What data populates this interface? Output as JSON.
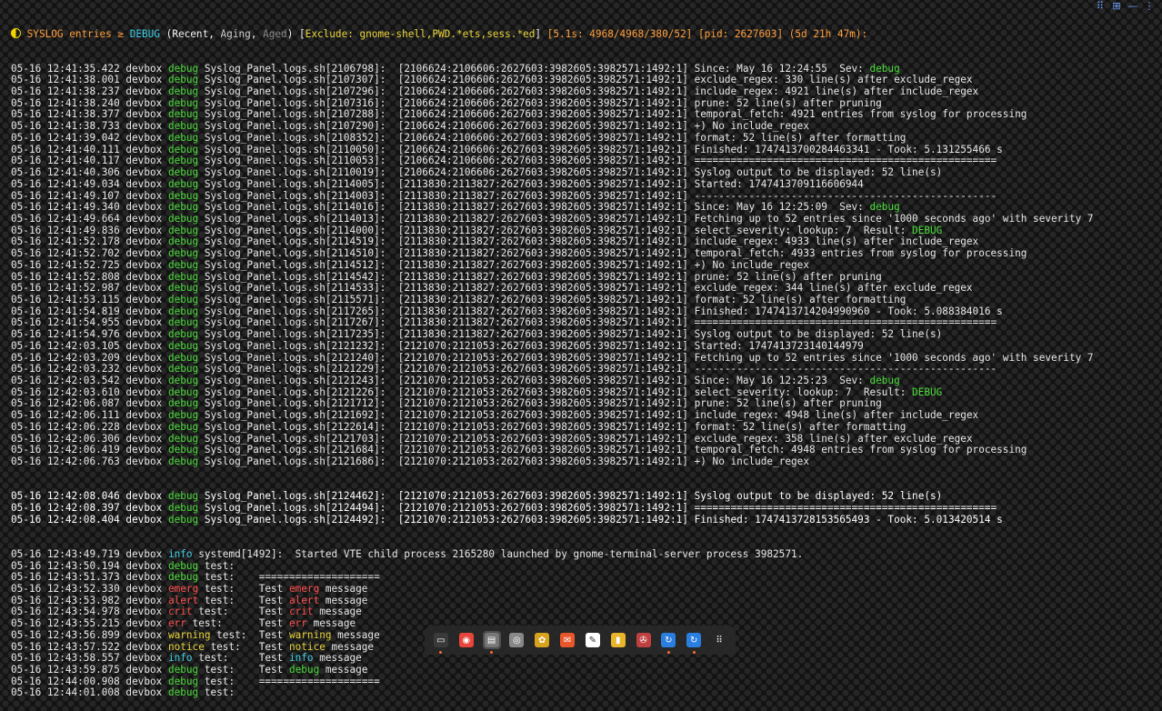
{
  "header": {
    "parts": [
      {
        "text": " SYSLOG entries ",
        "cls": "orange"
      },
      {
        "text": "≥ ",
        "cls": "orange"
      },
      {
        "text": "DEBUG",
        "cls": "cyan"
      },
      {
        "text": " (",
        "cls": "wht"
      },
      {
        "text": "Recent",
        "cls": "wht"
      },
      {
        "text": ", ",
        "cls": "wht"
      },
      {
        "text": "Aging",
        "cls": "dim"
      },
      {
        "text": ", ",
        "cls": "wht"
      },
      {
        "text": "Aged",
        "cls": "gry"
      },
      {
        "text": ") [",
        "cls": "wht"
      },
      {
        "text": "Exclude: gnome-shell,PWD.*ets,sess.*ed",
        "cls": "yel"
      },
      {
        "text": "] ",
        "cls": "wht"
      },
      {
        "text": "[5.1s: 4968/4968/380/52] [pid: 2627603] (5d 21h 47m):",
        "cls": "orange"
      }
    ]
  },
  "colors": {
    "background": "#121212",
    "text": "#e8e8e8",
    "orange": "#ff9e3d",
    "debug": "#4cdc3c",
    "cyan": "#3fd0e8",
    "red": "#ff4d4d",
    "yellow": "#e9d43a"
  },
  "debug_lines": [
    [
      "05-16 12:41:35.422",
      "Syslog_Panel.logs.sh[2106798]:",
      "[2106624:2106606:2627603:3982605:3982571:1492:1]",
      [
        {
          "t": "Since: May 16 12:24:55  Sev: "
        },
        {
          "t": "debug",
          "c": "grn"
        }
      ]
    ],
    [
      "05-16 12:41:38.001",
      "Syslog_Panel.logs.sh[2107307]:",
      "[2106624:2106606:2627603:3982605:3982571:1492:1]",
      [
        {
          "t": "exclude_regex: 330 line(s) after exclude_regex"
        }
      ]
    ],
    [
      "05-16 12:41:38.237",
      "Syslog_Panel.logs.sh[2107296]:",
      "[2106624:2106606:2627603:3982605:3982571:1492:1]",
      [
        {
          "t": "include_regex: 4921 line(s) after include_regex"
        }
      ]
    ],
    [
      "05-16 12:41:38.240",
      "Syslog_Panel.logs.sh[2107316]:",
      "[2106624:2106606:2627603:3982605:3982571:1492:1]",
      [
        {
          "t": "prune: 52 line(s) after pruning"
        }
      ]
    ],
    [
      "05-16 12:41:38.377",
      "Syslog_Panel.logs.sh[2107288]:",
      "[2106624:2106606:2627603:3982605:3982571:1492:1]",
      [
        {
          "t": "temporal_fetch: 4921 entries from syslog for processing"
        }
      ]
    ],
    [
      "05-16 12:41:38.733",
      "Syslog_Panel.logs.sh[2107290]:",
      "[2106624:2106606:2627603:3982605:3982571:1492:1]",
      [
        {
          "t": "+) No include_regex"
        }
      ]
    ],
    [
      "05-16 12:41:39.042",
      "Syslog_Panel.logs.sh[2108352]:",
      "[2106624:2106606:2627603:3982605:3982571:1492:1]",
      [
        {
          "t": "format: 52 line(s) after formatting"
        }
      ]
    ],
    [
      "05-16 12:41:40.111",
      "Syslog_Panel.logs.sh[2110050]:",
      "[2106624:2106606:2627603:3982605:3982571:1492:1]",
      [
        {
          "t": "Finished: 1747413700284463341 - Took: 5.131255466 s"
        }
      ]
    ],
    [
      "05-16 12:41:40.117",
      "Syslog_Panel.logs.sh[2110053]:",
      "[2106624:2106606:2627603:3982605:3982571:1492:1]",
      [
        {
          "t": "=================================================="
        }
      ]
    ],
    [
      "05-16 12:41:40.306",
      "Syslog_Panel.logs.sh[2110019]:",
      "[2106624:2106606:2627603:3982605:3982571:1492:1]",
      [
        {
          "t": "Syslog output to be displayed: 52 line(s)"
        }
      ]
    ],
    [
      "05-16 12:41:49.034",
      "Syslog_Panel.logs.sh[2114005]:",
      "[2113830:2113827:2627603:3982605:3982571:1492:1]",
      [
        {
          "t": "Started: 1747413709116606944"
        }
      ]
    ],
    [
      "05-16 12:41:49.107",
      "Syslog_Panel.logs.sh[2114003]:",
      "[2113830:2113827:2627603:3982605:3982571:1492:1]",
      [
        {
          "t": "--------------------------------------------------"
        }
      ]
    ],
    [
      "05-16 12:41:49.340",
      "Syslog_Panel.logs.sh[2114016]:",
      "[2113830:2113827:2627603:3982605:3982571:1492:1]",
      [
        {
          "t": "Since: May 16 12:25:09  Sev: "
        },
        {
          "t": "debug",
          "c": "grn"
        }
      ]
    ],
    [
      "05-16 12:41:49.664",
      "Syslog_Panel.logs.sh[2114013]:",
      "[2113830:2113827:2627603:3982605:3982571:1492:1]",
      [
        {
          "t": "Fetching up to 52 entries since '1000 seconds ago' with severity 7"
        }
      ]
    ],
    [
      "05-16 12:41:49.836",
      "Syslog_Panel.logs.sh[2114000]:",
      "[2113830:2113827:2627603:3982605:3982571:1492:1]",
      [
        {
          "t": "select_severity: lookup: 7  Result: "
        },
        {
          "t": "DEBUG",
          "c": "grn"
        }
      ]
    ],
    [
      "05-16 12:41:52.178",
      "Syslog_Panel.logs.sh[2114519]:",
      "[2113830:2113827:2627603:3982605:3982571:1492:1]",
      [
        {
          "t": "include_regex: 4933 line(s) after include_regex"
        }
      ]
    ],
    [
      "05-16 12:41:52.702",
      "Syslog_Panel.logs.sh[2114510]:",
      "[2113830:2113827:2627603:3982605:3982571:1492:1]",
      [
        {
          "t": "temporal_fetch: 4933 entries from syslog for processing"
        }
      ]
    ],
    [
      "05-16 12:41:52.725",
      "Syslog_Panel.logs.sh[2114512]:",
      "[2113830:2113827:2627603:3982605:3982571:1492:1]",
      [
        {
          "t": "+) No include_regex"
        }
      ]
    ],
    [
      "05-16 12:41:52.808",
      "Syslog_Panel.logs.sh[2114542]:",
      "[2113830:2113827:2627603:3982605:3982571:1492:1]",
      [
        {
          "t": "prune: 52 line(s) after pruning"
        }
      ]
    ],
    [
      "05-16 12:41:52.987",
      "Syslog_Panel.logs.sh[2114533]:",
      "[2113830:2113827:2627603:3982605:3982571:1492:1]",
      [
        {
          "t": "exclude_regex: 344 line(s) after exclude_regex"
        }
      ]
    ],
    [
      "05-16 12:41:53.115",
      "Syslog_Panel.logs.sh[2115571]:",
      "[2113830:2113827:2627603:3982605:3982571:1492:1]",
      [
        {
          "t": "format: 52 line(s) after formatting"
        }
      ]
    ],
    [
      "05-16 12:41:54.819",
      "Syslog_Panel.logs.sh[2117265]:",
      "[2113830:2113827:2627603:3982605:3982571:1492:1]",
      [
        {
          "t": "Finished: 1747413714204990960 - Took: 5.088384016 s"
        }
      ]
    ],
    [
      "05-16 12:41:54.955",
      "Syslog_Panel.logs.sh[2117267]:",
      "[2113830:2113827:2627603:3982605:3982571:1492:1]",
      [
        {
          "t": "=================================================="
        }
      ]
    ],
    [
      "05-16 12:41:54.976",
      "Syslog_Panel.logs.sh[2117235]:",
      "[2113830:2113827:2627603:3982605:3982571:1492:1]",
      [
        {
          "t": "Syslog output to be displayed: 52 line(s)"
        }
      ]
    ],
    [
      "05-16 12:42:03.105",
      "Syslog_Panel.logs.sh[2121232]:",
      "[2121070:2121053:2627603:3982605:3982571:1492:1]",
      [
        {
          "t": "Started: 1747413723140144979"
        }
      ]
    ],
    [
      "05-16 12:42:03.209",
      "Syslog_Panel.logs.sh[2121240]:",
      "[2121070:2121053:2627603:3982605:3982571:1492:1]",
      [
        {
          "t": "Fetching up to 52 entries since '1000 seconds ago' with severity 7"
        }
      ]
    ],
    [
      "05-16 12:42:03.232",
      "Syslog_Panel.logs.sh[2121229]:",
      "[2121070:2121053:2627603:3982605:3982571:1492:1]",
      [
        {
          "t": "--------------------------------------------------"
        }
      ]
    ],
    [
      "05-16 12:42:03.542",
      "Syslog_Panel.logs.sh[2121243]:",
      "[2121070:2121053:2627603:3982605:3982571:1492:1]",
      [
        {
          "t": "Since: May 16 12:25:23  Sev: "
        },
        {
          "t": "debug",
          "c": "grn"
        }
      ]
    ],
    [
      "05-16 12:42:03.610",
      "Syslog_Panel.logs.sh[2121226]:",
      "[2121070:2121053:2627603:3982605:3982571:1492:1]",
      [
        {
          "t": "select_severity: lookup: 7  Result: "
        },
        {
          "t": "DEBUG",
          "c": "grn"
        }
      ]
    ],
    [
      "05-16 12:42:06.087",
      "Syslog_Panel.logs.sh[2121712]:",
      "[2121070:2121053:2627603:3982605:3982571:1492:1]",
      [
        {
          "t": "prune: 52 line(s) after pruning"
        }
      ]
    ],
    [
      "05-16 12:42:06.111",
      "Syslog_Panel.logs.sh[2121692]:",
      "[2121070:2121053:2627603:3982605:3982571:1492:1]",
      [
        {
          "t": "include_regex: 4948 line(s) after include_regex"
        }
      ]
    ],
    [
      "05-16 12:42:06.228",
      "Syslog_Panel.logs.sh[2122614]:",
      "[2121070:2121053:2627603:3982605:3982571:1492:1]",
      [
        {
          "t": "format: 52 line(s) after formatting"
        }
      ]
    ],
    [
      "05-16 12:42:06.306",
      "Syslog_Panel.logs.sh[2121703]:",
      "[2121070:2121053:2627603:3982605:3982571:1492:1]",
      [
        {
          "t": "exclude_regex: 358 line(s) after exclude_regex"
        }
      ]
    ],
    [
      "05-16 12:42:06.419",
      "Syslog_Panel.logs.sh[2121684]:",
      "[2121070:2121053:2627603:3982605:3982571:1492:1]",
      [
        {
          "t": "temporal_fetch: 4948 entries from syslog for processing"
        }
      ]
    ],
    [
      "05-16 12:42:06.763",
      "Syslog_Panel.logs.sh[2121686]:",
      "[2121070:2121053:2627603:3982605:3982571:1492:1]",
      [
        {
          "t": "+) No include_regex"
        }
      ]
    ]
  ],
  "recent_lines": [
    [
      "05-16 12:42:08.046",
      "Syslog_Panel.logs.sh[2124462]:",
      "[2121070:2121053:2627603:3982605:3982571:1492:1]",
      [
        {
          "t": "Syslog output to be displayed: 52 line(s)"
        }
      ]
    ],
    [
      "05-16 12:42:08.397",
      "Syslog_Panel.logs.sh[2124494]:",
      "[2121070:2121053:2627603:3982605:3982571:1492:1]",
      [
        {
          "t": "=================================================="
        }
      ]
    ],
    [
      "05-16 12:42:08.404",
      "Syslog_Panel.logs.sh[2124492]:",
      "[2121070:2121053:2627603:3982605:3982571:1492:1]",
      [
        {
          "t": "Finished: 1747413728153565493 - Took: 5.013420514 s"
        }
      ]
    ]
  ],
  "tail_lines": [
    {
      "ts": "05-16 12:43:49.719",
      "host": "devbox",
      "sev": "info",
      "sevc": "cyan",
      "rest": [
        {
          "t": " systemd[1492]:  Started VTE child process 2165280 launched by gnome-terminal-server process 3982571."
        }
      ]
    },
    {
      "ts": "05-16 12:43:50.194",
      "host": "devbox",
      "sev": "debug",
      "sevc": "grn",
      "rest": [
        {
          "t": " test:"
        }
      ]
    },
    {
      "ts": "05-16 12:43:51.373",
      "host": "devbox",
      "sev": "debug",
      "sevc": "grn",
      "rest": [
        {
          "t": " test:    ===================="
        }
      ]
    },
    {
      "ts": "05-16 12:43:52.330",
      "host": "devbox",
      "sev": "emerg",
      "sevc": "red",
      "rest": [
        {
          "t": " test:    Test "
        },
        {
          "t": "emerg",
          "c": "red"
        },
        {
          "t": " message"
        }
      ]
    },
    {
      "ts": "05-16 12:43:53.982",
      "host": "devbox",
      "sev": "alert",
      "sevc": "red",
      "rest": [
        {
          "t": " test:    Test "
        },
        {
          "t": "alert",
          "c": "red"
        },
        {
          "t": " message"
        }
      ]
    },
    {
      "ts": "05-16 12:43:54.978",
      "host": "devbox",
      "sev": "crit",
      "sevc": "red",
      "rest": [
        {
          "t": " test:     Test "
        },
        {
          "t": "crit",
          "c": "red"
        },
        {
          "t": " message"
        }
      ]
    },
    {
      "ts": "05-16 12:43:55.215",
      "host": "devbox",
      "sev": "err",
      "sevc": "red",
      "rest": [
        {
          "t": " test:      Test "
        },
        {
          "t": "err",
          "c": "red"
        },
        {
          "t": " message"
        }
      ]
    },
    {
      "ts": "05-16 12:43:56.899",
      "host": "devbox",
      "sev": "warning",
      "sevc": "yel",
      "rest": [
        {
          "t": " test:  Test "
        },
        {
          "t": "warning",
          "c": "yel"
        },
        {
          "t": " message"
        }
      ]
    },
    {
      "ts": "05-16 12:43:57.522",
      "host": "devbox",
      "sev": "notice",
      "sevc": "yel",
      "rest": [
        {
          "t": " test:   Test "
        },
        {
          "t": "notice",
          "c": "yel"
        },
        {
          "t": " message"
        }
      ]
    },
    {
      "ts": "05-16 12:43:58.557",
      "host": "devbox",
      "sev": "info",
      "sevc": "cyan",
      "rest": [
        {
          "t": " test:     Test "
        },
        {
          "t": "info",
          "c": "cyan"
        },
        {
          "t": " message"
        }
      ]
    },
    {
      "ts": "05-16 12:43:59.875",
      "host": "devbox",
      "sev": "debug",
      "sevc": "grn",
      "rest": [
        {
          "t": " test:    Test "
        },
        {
          "t": "debug",
          "c": "grn"
        },
        {
          "t": " message"
        }
      ]
    },
    {
      "ts": "05-16 12:44:00.908",
      "host": "devbox",
      "sev": "debug",
      "sevc": "grn",
      "rest": [
        {
          "t": " test:    ===================="
        }
      ]
    },
    {
      "ts": "05-16 12:44:01.008",
      "host": "devbox",
      "sev": "debug",
      "sevc": "grn",
      "rest": [
        {
          "t": " test:"
        }
      ]
    }
  ],
  "host": "devbox",
  "debug_sev": "debug",
  "topright_icons": [
    "grid-icon",
    "layout-icon",
    "minimize-icon",
    "dots-icon"
  ],
  "dock": [
    {
      "name": "terminal-icon",
      "glyph": "▭",
      "bg": "#3a3a3a",
      "dot": true
    },
    {
      "name": "chrome-icon",
      "glyph": "◉",
      "bg": "#e8453c",
      "dot": false
    },
    {
      "name": "files-icon",
      "glyph": "▤",
      "bg": "#777777",
      "dot": true,
      "active": true
    },
    {
      "name": "settings-icon",
      "glyph": "◎",
      "bg": "#888888",
      "dot": false
    },
    {
      "name": "bug-icon",
      "glyph": "✿",
      "bg": "#d8a31c",
      "dot": false
    },
    {
      "name": "mail-icon",
      "glyph": "✉",
      "bg": "#e8572b",
      "dot": false
    },
    {
      "name": "text-editor-icon",
      "glyph": "✎",
      "bg": "#ffffff",
      "dot": false
    },
    {
      "name": "archive-icon",
      "glyph": "▮",
      "bg": "#e8b52b",
      "dot": false
    },
    {
      "name": "tools-icon",
      "glyph": "✇",
      "bg": "#c04040",
      "dot": false
    },
    {
      "name": "sync-icon",
      "glyph": "↻",
      "bg": "#2a7ee0",
      "dot": true
    },
    {
      "name": "sync2-icon",
      "glyph": "↻",
      "bg": "#2a7ee0",
      "dot": true
    },
    {
      "name": "apps-grid-icon",
      "glyph": "⠿",
      "bg": "transparent",
      "dot": false
    }
  ]
}
